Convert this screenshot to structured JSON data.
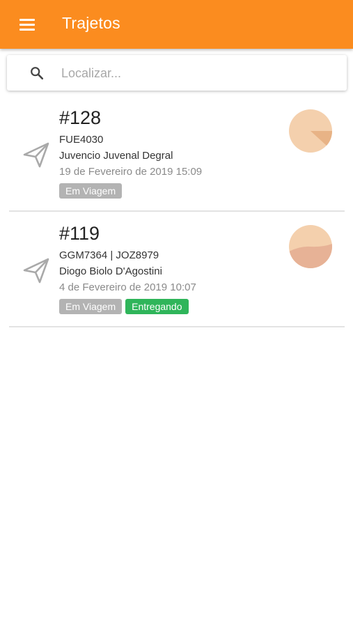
{
  "appbar": {
    "title": "Trajetos",
    "menu_icon": "menu-icon",
    "color": "#fb8c1f"
  },
  "search": {
    "icon": "search-icon",
    "placeholder": "Localizar...",
    "value": ""
  },
  "trips": [
    {
      "id": "#128",
      "plates": "FUE4030",
      "driver": "Juvencio Juvenal Degral",
      "date": "19 de Fevereiro de 2019 15:09",
      "icon": "send-icon",
      "badges": [
        {
          "label": "Em Viagem",
          "color": "#b3b3b3"
        }
      ],
      "progress_icon": "pie-progress-icon"
    },
    {
      "id": "#119",
      "plates": "GGM7364 | JOZ8979",
      "driver": "Diogo Biolo D'Agostini",
      "date": "4 de Fevereiro de 2019 10:07",
      "icon": "send-icon",
      "badges": [
        {
          "label": "Em Viagem",
          "color": "#b3b3b3"
        },
        {
          "label": "Entregando",
          "color": "#2fb55a"
        }
      ],
      "progress_icon": "wave-progress-icon"
    }
  ]
}
